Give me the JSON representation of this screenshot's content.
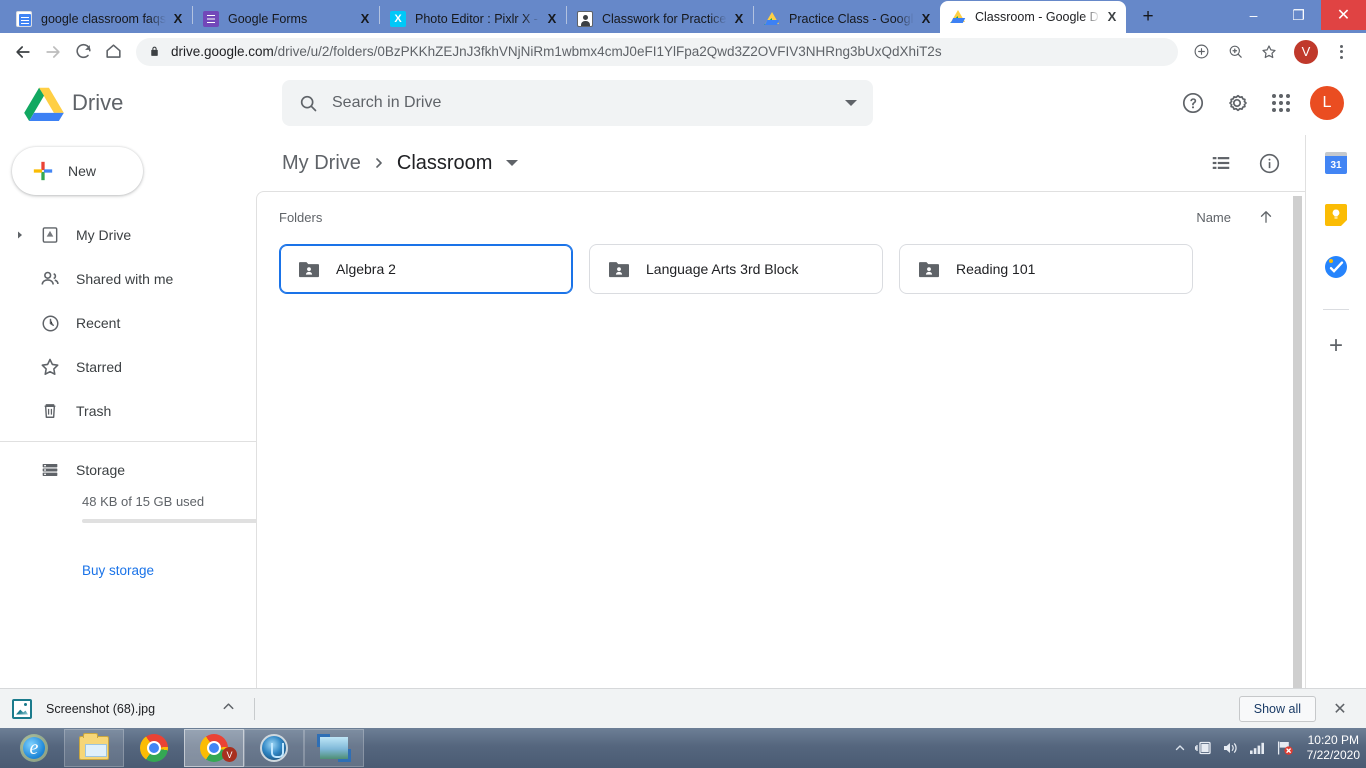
{
  "window": {
    "minimize_label": "–",
    "restore_label": "❐",
    "close_label": "✕"
  },
  "tabs": [
    {
      "title": "google classroom faqs a",
      "icon": "docs-icon",
      "close_label": "X",
      "active": false
    },
    {
      "title": "Google Forms",
      "icon": "forms-icon",
      "close_label": "X",
      "active": false
    },
    {
      "title": "Photo Editor : Pixlr X - fre",
      "icon": "pixlr-icon",
      "close_label": "X",
      "active": false
    },
    {
      "title": "Classwork for Practice Cl",
      "icon": "classroom-icon",
      "close_label": "X",
      "active": false
    },
    {
      "title": "Practice Class - Google D",
      "icon": "drive-icon",
      "close_label": "X",
      "active": false
    },
    {
      "title": "Classroom - Google Driv",
      "icon": "drive-icon",
      "close_label": "X",
      "active": true
    }
  ],
  "new_tab_label": "+",
  "toolbar": {
    "back_icon": "back-arrow-icon",
    "forward_icon": "forward-arrow-icon",
    "reload_icon": "reload-icon",
    "home_icon": "home-icon",
    "lock_icon": "lock-icon",
    "url_domain": "drive.google.com",
    "url_path": "/drive/u/2/folders/0BzPKKhZEJnJ3fkhVNjNiRm1wbmx4cmJ0eFI1YlFpa2Qwd3Z2OVFIV3NHRng3bUxQdXhiT2s",
    "install_icon": "install-app-icon",
    "zoom_icon": "zoom-magnifier-icon",
    "bookmark_icon": "star-icon",
    "profile_initial": "V",
    "menu_icon": "three-dot-menu-icon"
  },
  "drive": {
    "brand": "Drive",
    "logo_icon": "google-drive-logo",
    "search": {
      "placeholder": "Search in Drive",
      "value": "",
      "icon": "search-icon",
      "options_icon": "search-options-caret"
    },
    "header_icons": [
      {
        "name": "help-icon",
        "label": "?"
      },
      {
        "name": "settings-gear-icon",
        "label": ""
      },
      {
        "name": "google-apps-grid-icon",
        "label": ""
      }
    ],
    "account_initial": "L",
    "new_button": {
      "label": "New",
      "icon": "plus-colored-icon"
    },
    "nav_items": [
      {
        "label": "My Drive",
        "icon": "my-drive-icon",
        "expandable": true
      },
      {
        "label": "Shared with me",
        "icon": "shared-with-me-icon",
        "expandable": false
      },
      {
        "label": "Recent",
        "icon": "clock-icon",
        "expandable": false
      },
      {
        "label": "Starred",
        "icon": "star-outline-icon",
        "expandable": false
      },
      {
        "label": "Trash",
        "icon": "trash-icon",
        "expandable": false
      }
    ],
    "storage": {
      "label": "Storage",
      "icon": "storage-icon",
      "used_text": "48 KB of 15 GB used",
      "buy_label": "Buy storage"
    },
    "breadcrumb": {
      "root": "My Drive",
      "separator": "›",
      "current": "Classroom",
      "caret_icon": "chevron-down-icon"
    },
    "view_icons": [
      {
        "name": "list-view-icon"
      },
      {
        "name": "details-info-icon"
      }
    ],
    "section": {
      "title": "Folders",
      "sort_label": "Name",
      "sort_direction_icon": "arrow-up-icon"
    },
    "folders": [
      {
        "name": "Algebra 2",
        "icon": "shared-folder-icon",
        "selected": true
      },
      {
        "name": "Language Arts 3rd Block",
        "icon": "shared-folder-icon",
        "selected": false
      },
      {
        "name": "Reading 101",
        "icon": "shared-folder-icon",
        "selected": false
      }
    ],
    "side_apps": [
      {
        "name": "google-calendar-icon",
        "label": "31"
      },
      {
        "name": "google-keep-icon",
        "label": ""
      },
      {
        "name": "google-tasks-icon",
        "label": ""
      }
    ],
    "side_add_label": "+",
    "side_expand_icon": "chevron-right-icon"
  },
  "downloads": {
    "file_name": "Screenshot (68).jpg",
    "file_icon": "image-file-icon",
    "menu_icon": "chevron-up-icon",
    "show_all_label": "Show all",
    "close_label": "✕"
  },
  "taskbar": {
    "items": [
      {
        "name": "internet-explorer-icon",
        "state": "pinned"
      },
      {
        "name": "file-explorer-icon",
        "state": "pinned"
      },
      {
        "name": "chrome-icon",
        "state": "pinned"
      },
      {
        "name": "chrome-window-icon",
        "state": "active",
        "badge": "V"
      },
      {
        "name": "media-player-orb-icon",
        "state": "pinned"
      },
      {
        "name": "photos-app-icon",
        "state": "pinned"
      }
    ],
    "tray": [
      {
        "name": "show-hidden-icons-chevron"
      },
      {
        "name": "battery-charging-icon"
      },
      {
        "name": "volume-icon"
      },
      {
        "name": "network-signal-icon"
      },
      {
        "name": "action-center-alert-icon"
      }
    ],
    "time": "10:20 PM",
    "date": "7/22/2020"
  },
  "colors": {
    "chrome_frame": "#6688c9",
    "drive_blue": "#1a73e8",
    "accent_orange": "#ea4d21",
    "profile_red": "#c0392b"
  }
}
